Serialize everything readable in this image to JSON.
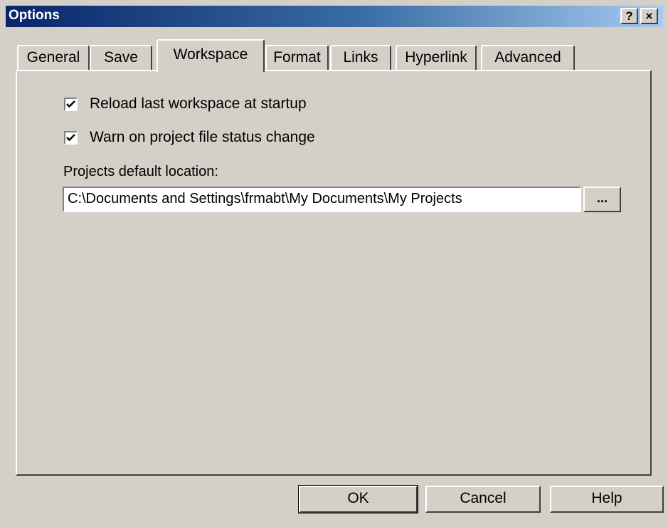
{
  "window": {
    "title": "Options",
    "help_button": "?",
    "close_button": "×"
  },
  "tabs": [
    {
      "label": "General"
    },
    {
      "label": "Save"
    },
    {
      "label": "Workspace"
    },
    {
      "label": "Format"
    },
    {
      "label": "Links"
    },
    {
      "label": "Hyperlink"
    },
    {
      "label": "Advanced"
    }
  ],
  "active_tab": "Workspace",
  "workspace": {
    "reload_label": "Reload last workspace at startup",
    "reload_checked": true,
    "warn_label": "Warn on project file status change",
    "warn_checked": true,
    "location_label": "Projects default location:",
    "location_value": "C:\\Documents and Settings\\frmabt\\My Documents\\My Projects",
    "browse_label": "..."
  },
  "footer": {
    "ok_label": "OK",
    "cancel_label": "Cancel",
    "help_label": "Help"
  }
}
